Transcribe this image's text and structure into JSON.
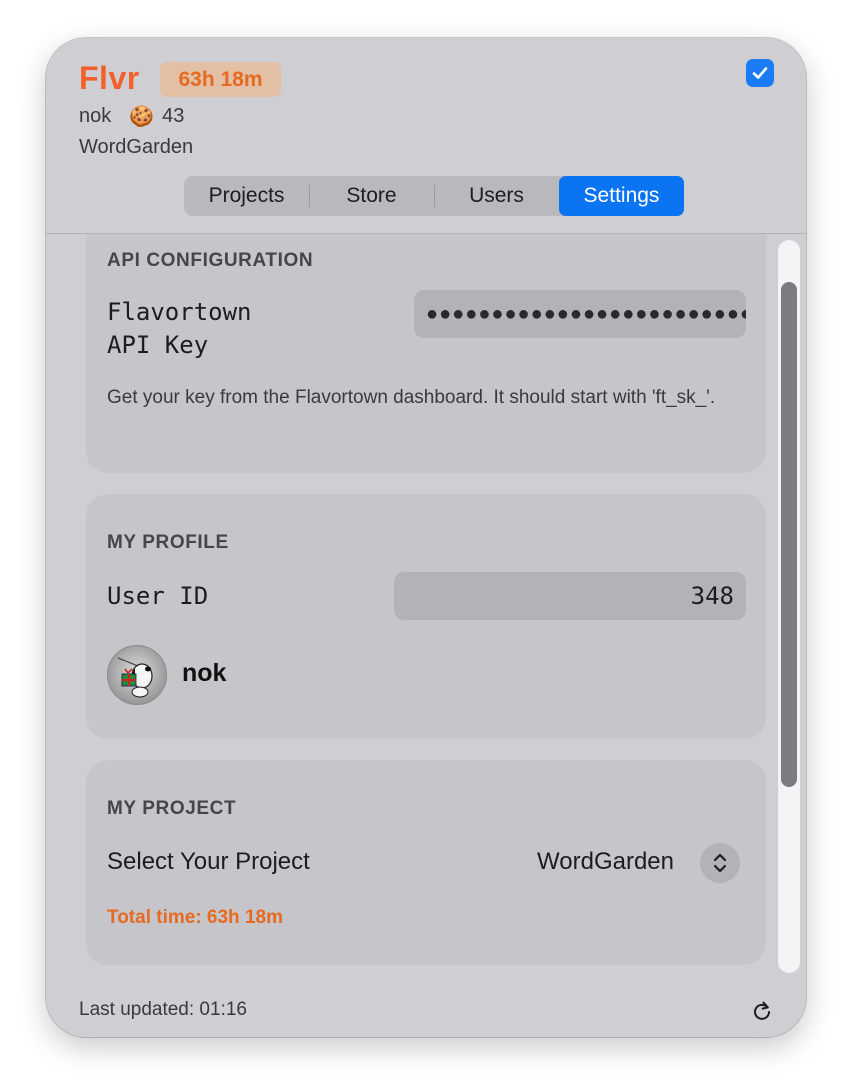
{
  "app": {
    "name": "Flvr",
    "total_time_badge": "63h 18m",
    "username": "nok",
    "cookie_icon": "cookie-emoji",
    "cookie_glyph": "🍪",
    "cookie_count": "43",
    "current_project": "WordGarden",
    "checkbox_checked": true
  },
  "tabs": [
    {
      "label": "Projects",
      "active": false
    },
    {
      "label": "Store",
      "active": false
    },
    {
      "label": "Users",
      "active": false
    },
    {
      "label": "Settings",
      "active": true
    }
  ],
  "api_config": {
    "section_title": "API CONFIGURATION",
    "label_line1": "Flavortown",
    "label_line2": "API Key",
    "masked_value": "●●●●●●●●●●●●●●●●●●●●●●●●●",
    "help_text": "Get your key from the Flavortown dashboard. It should start with 'ft_sk_'."
  },
  "profile": {
    "section_title": "MY PROFILE",
    "user_id_label": "User ID",
    "user_id_value": "348",
    "name": "nok"
  },
  "project": {
    "section_title": "MY PROJECT",
    "select_label": "Select Your Project",
    "selected": "WordGarden",
    "total_time": "Total time: 63h 18m"
  },
  "footer": {
    "last_updated": "Last updated: 01:16"
  },
  "colors": {
    "brand": "#f2612a",
    "accent_blue": "#0a74f2",
    "time_orange": "#e66a1f"
  }
}
